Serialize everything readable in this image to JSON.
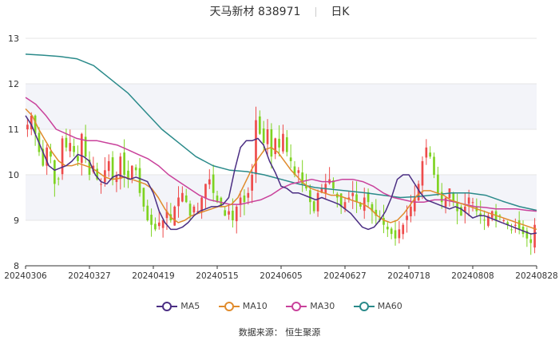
{
  "header": {
    "title": "天马新材 838971",
    "period": "日K"
  },
  "source": "数据来源： 恒生聚源",
  "colors": {
    "up": "#ee4b4b",
    "down": "#7ed321",
    "ma5": "#4b2e83",
    "ma10": "#e08b2c",
    "ma30": "#c9419b",
    "ma60": "#2a8a8a",
    "grid": "#e6e6e6",
    "axis": "#333333"
  },
  "chart_data": {
    "type": "candlestick",
    "ylim": [
      8,
      13
    ],
    "yticks": [
      8,
      9,
      10,
      11,
      12,
      13
    ],
    "x_tick_labels": [
      "20240306",
      "20240327",
      "20240419",
      "20240515",
      "20240605",
      "20240627",
      "20240718",
      "20240808",
      "20240828"
    ],
    "legend": [
      "MA5",
      "MA10",
      "MA30",
      "MA60"
    ],
    "closes": [
      11.1,
      11.3,
      10.9,
      10.5,
      10.2,
      10.6,
      10.4,
      9.8,
      9.9,
      10.8,
      10.6,
      10.7,
      10.5,
      10.3,
      10.9,
      10.4,
      10.0,
      10.2,
      9.9,
      9.8,
      10.1,
      10.3,
      9.9,
      10.0,
      10.4,
      10.0,
      9.9,
      10.2,
      10.1,
      9.6,
      9.3,
      9.0,
      8.9,
      8.8,
      8.95,
      9.0,
      9.2,
      9.0,
      9.3,
      9.5,
      9.6,
      9.4,
      9.1,
      9.3,
      9.2,
      9.5,
      9.8,
      9.9,
      9.6,
      9.4,
      9.3,
      9.1,
      9.2,
      9.0,
      9.3,
      9.5,
      9.4,
      9.6,
      10.0,
      11.2,
      10.9,
      10.7,
      11.0,
      10.4,
      10.8,
      10.6,
      10.9,
      10.5,
      10.3,
      10.0,
      10.1,
      9.8,
      9.7,
      9.4,
      9.2,
      9.6,
      9.7,
      9.8,
      9.9,
      9.7,
      9.5,
      9.3,
      9.4,
      9.5,
      9.6,
      9.4,
      9.3,
      9.5,
      9.4,
      9.2,
      9.1,
      9.0,
      8.9,
      8.8,
      8.7,
      8.6,
      8.8,
      8.9,
      9.1,
      9.3,
      9.5,
      9.8,
      10.3,
      10.6,
      10.4,
      10.0,
      9.6,
      9.4,
      9.5,
      9.7,
      9.4,
      9.2,
      9.1,
      9.3,
      9.5,
      9.4,
      9.2,
      9.1,
      9.0,
      9.1,
      9.2,
      9.0,
      9.1,
      9.0,
      8.9,
      8.8,
      8.9,
      8.8,
      8.7,
      8.6,
      8.5,
      8.9
    ],
    "ma5": [
      11.3,
      11.1,
      10.8,
      10.5,
      10.2,
      10.1,
      10.15,
      10.2,
      10.3,
      10.45,
      10.4,
      10.3,
      10.0,
      9.85,
      9.8,
      9.95,
      10.0,
      9.95,
      9.9,
      9.95,
      9.9,
      9.85,
      9.6,
      9.2,
      8.95,
      8.8,
      8.8,
      8.85,
      8.95,
      9.1,
      9.2,
      9.25,
      9.3,
      9.3,
      9.35,
      9.5,
      10.1,
      10.6,
      10.75,
      10.75,
      10.8,
      10.65,
      10.3,
      10.05,
      9.75,
      9.7,
      9.6,
      9.6,
      9.55,
      9.5,
      9.45,
      9.5,
      9.45,
      9.4,
      9.35,
      9.25,
      9.15,
      9.0,
      8.85,
      8.8,
      8.85,
      9.0,
      9.2,
      9.5,
      9.9,
      10.0,
      10.0,
      9.8,
      9.6,
      9.45,
      9.4,
      9.35,
      9.3,
      9.25,
      9.3,
      9.25,
      9.15,
      9.05,
      9.1,
      9.1,
      9.05,
      9.0,
      8.95,
      8.9,
      8.85,
      8.8,
      8.75,
      8.7,
      8.72
    ],
    "ma10": [
      11.45,
      11.3,
      11.0,
      10.75,
      10.5,
      10.3,
      10.2,
      10.2,
      10.25,
      10.2,
      10.15,
      10.05,
      9.95,
      9.9,
      9.92,
      9.95,
      9.9,
      9.85,
      9.8,
      9.7,
      9.5,
      9.25,
      9.05,
      8.95,
      9.0,
      9.1,
      9.15,
      9.2,
      9.25,
      9.3,
      9.3,
      9.35,
      9.5,
      9.8,
      10.1,
      10.35,
      10.55,
      10.6,
      10.5,
      10.3,
      10.1,
      9.95,
      9.8,
      9.7,
      9.65,
      9.6,
      9.55,
      9.55,
      9.5,
      9.45,
      9.4,
      9.35,
      9.25,
      9.1,
      9.0,
      8.95,
      9.0,
      9.15,
      9.35,
      9.55,
      9.65,
      9.65,
      9.6,
      9.55,
      9.45,
      9.4,
      9.35,
      9.3,
      9.25,
      9.2,
      9.15,
      9.1,
      9.05,
      9.0,
      8.95,
      8.9,
      8.85,
      8.8
    ],
    "ma30": [
      11.7,
      11.55,
      11.3,
      11.0,
      10.9,
      10.8,
      10.75,
      10.75,
      10.7,
      10.65,
      10.55,
      10.45,
      10.35,
      10.2,
      10.0,
      9.85,
      9.7,
      9.55,
      9.45,
      9.4,
      9.35,
      9.35,
      9.4,
      9.45,
      9.55,
      9.7,
      9.8,
      9.85,
      9.9,
      9.85,
      9.85,
      9.9,
      9.9,
      9.85,
      9.75,
      9.6,
      9.5,
      9.45,
      9.4,
      9.4,
      9.45,
      9.45,
      9.4,
      9.35,
      9.3,
      9.28,
      9.25,
      9.25,
      9.25,
      9.22,
      9.2
    ],
    "ma60": [
      12.65,
      12.63,
      12.6,
      12.55,
      12.4,
      12.1,
      11.8,
      11.4,
      11.0,
      10.7,
      10.4,
      10.2,
      10.1,
      10.07,
      10.0,
      9.9,
      9.8,
      9.72,
      9.68,
      9.64,
      9.6,
      9.55,
      9.5,
      9.52,
      9.56,
      9.6,
      9.6,
      9.55,
      9.42,
      9.3,
      9.22
    ]
  }
}
